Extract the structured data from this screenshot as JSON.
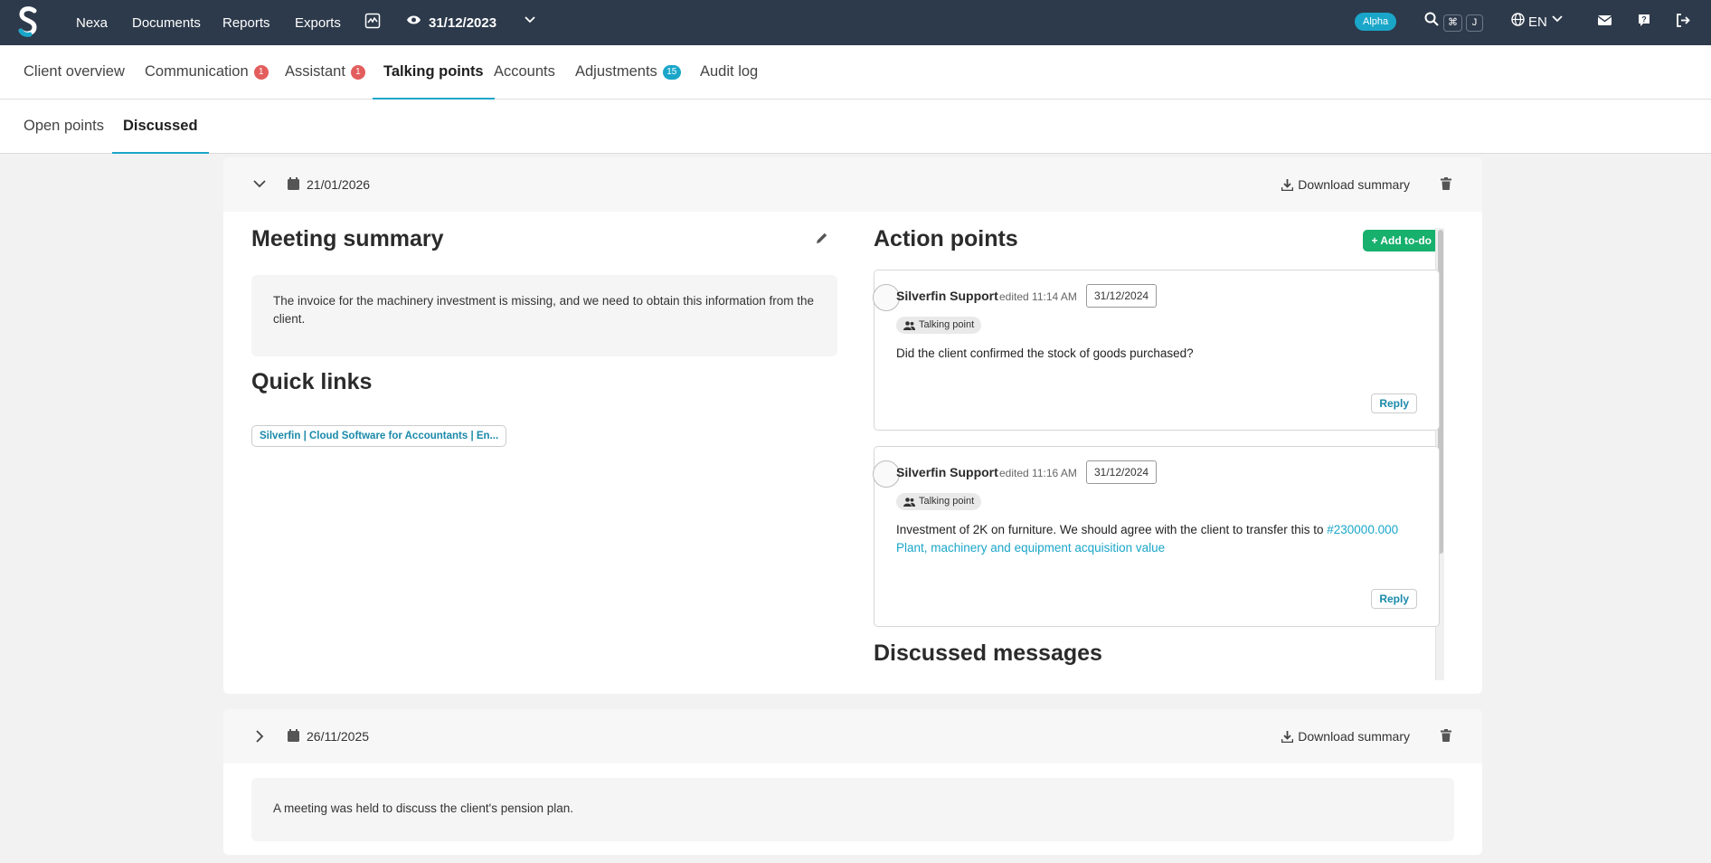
{
  "topbar": {
    "nav": [
      "Nexa",
      "Documents",
      "Reports",
      "Exports"
    ],
    "period": "31/12/2023",
    "badge": "Alpha",
    "shortcut": [
      "⌘",
      "J"
    ],
    "language": "EN"
  },
  "tabs": [
    {
      "label": "Client overview"
    },
    {
      "label": "Communication",
      "count": "1"
    },
    {
      "label": "Assistant",
      "count": "1"
    },
    {
      "label": "Talking points",
      "active": true
    },
    {
      "label": "Accounts"
    },
    {
      "label": "Adjustments",
      "count": "15"
    },
    {
      "label": "Audit log"
    }
  ],
  "subtabs": [
    {
      "label": "Open points"
    },
    {
      "label": "Discussed",
      "active": true
    }
  ],
  "meetings": [
    {
      "date": "21/01/2026",
      "download_label": "Download summary",
      "summary_title": "Meeting summary",
      "summary_text": "The invoice for the machinery investment is missing, and we need to obtain this information from the client.",
      "quick_links_title": "Quick links",
      "quick_link": "Silverfin | Cloud Software for Accountants | En...",
      "action_points_title": "Action points",
      "add_todo_label": "+ Add to-do",
      "action_points": [
        {
          "author": "Silverfin Support",
          "edited": "edited 11:14 AM",
          "date": "31/12/2024",
          "tag": "Talking point",
          "message": "Did the client confirmed the stock of goods purchased?",
          "reply_label": "Reply"
        },
        {
          "author": "Silverfin Support",
          "edited": "edited 11:16 AM",
          "date": "31/12/2024",
          "tag": "Talking point",
          "message": "Investment of 2K on furniture. We should agree with the client to transfer this to ",
          "message_link": "#230000.000 Plant, machinery and equipment acquisition value",
          "reply_label": "Reply"
        }
      ],
      "discussed_title": "Discussed messages"
    },
    {
      "date": "26/11/2025",
      "download_label": "Download summary",
      "summary_text": "A meeting was held to discuss the client's pension plan."
    }
  ],
  "colors": {
    "topbar": "#2d3a4b",
    "accent": "#1aa6c9",
    "add_todo": "#17b06d",
    "count_badge": "#e35d5d"
  }
}
